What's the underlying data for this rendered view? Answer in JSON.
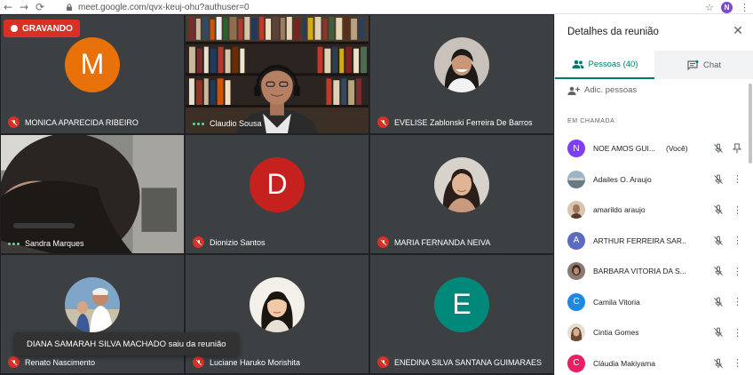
{
  "browser": {
    "url": "meet.google.com/qvx-keuj-ohu?authuser=0",
    "profile_initial": "N"
  },
  "meeting": {
    "recording_label": "GRAVANDO",
    "toast": "DIANA SAMARAH SILVA MACHADO saiu da reunião",
    "tiles": [
      {
        "name": "MONICA APARECIDA RIBEIRO",
        "letter": "M",
        "color": "#e8710a"
      },
      {
        "name": "Claudio Sousa"
      },
      {
        "name": "EVELISE Zablonski Ferreira De Barros"
      },
      {
        "name": "Sandra Marques"
      },
      {
        "name": "Dionizio Santos",
        "letter": "D",
        "color": "#c5221f"
      },
      {
        "name": "MARIA FERNANDA NEIVA"
      },
      {
        "name": "Renato Nascimento"
      },
      {
        "name": "Luciane Haruko Morishita"
      },
      {
        "name": "ENEDINA SILVA SANTANA GUIMARAES",
        "letter": "E",
        "color": "#00897b"
      }
    ]
  },
  "panel": {
    "title": "Detalhes da reunião",
    "tabs": {
      "people": "Pessoas (40)",
      "chat": "Chat"
    },
    "add_people": "Adic. pessoas",
    "section": "EM CHAMADA",
    "participants": [
      {
        "name": "NOE AMOS GUI...",
        "you": "(Você)",
        "letter": "N",
        "color": "#7e3ff2"
      },
      {
        "name": "Adailes O. Araujo",
        "letter": "",
        "color": "#8d9aa5"
      },
      {
        "name": "amarildo araujo",
        "letter": "",
        "color": "#a0765a"
      },
      {
        "name": "ARTHUR FERREIRA SAR...",
        "letter": "A",
        "color": "#5c6bc0"
      },
      {
        "name": "BARBARA VITORIA DA S...",
        "letter": "",
        "color": "#6d4c41"
      },
      {
        "name": "Camila Vitoria",
        "letter": "C",
        "color": "#1e88e5"
      },
      {
        "name": "Cintia Gomes",
        "letter": "",
        "color": "#b08968"
      },
      {
        "name": "Cláudia Makiyama",
        "letter": "C",
        "color": "#e91e63"
      }
    ]
  }
}
